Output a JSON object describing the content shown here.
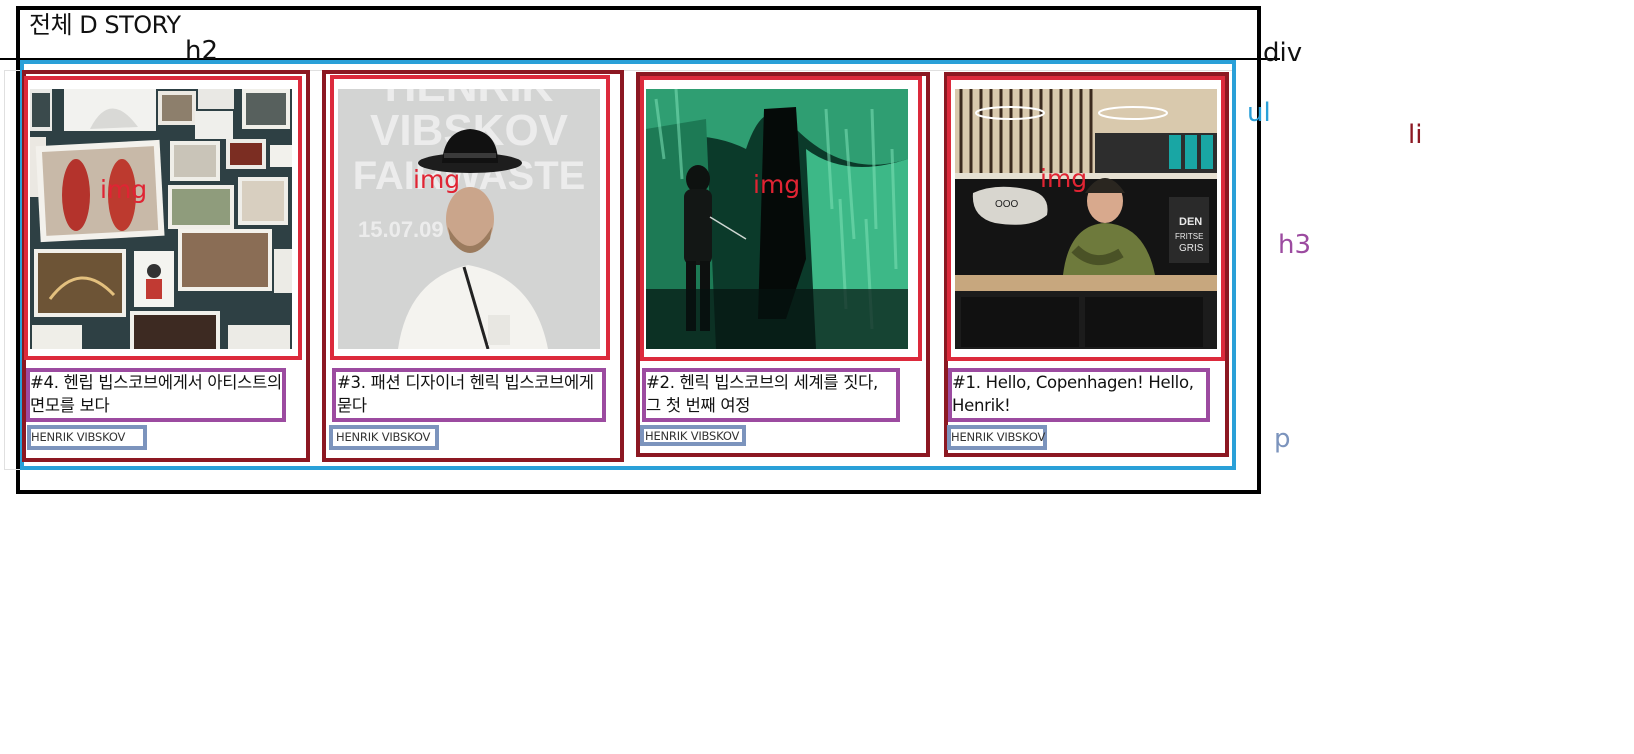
{
  "heading": "전체 D STORY",
  "labels": {
    "h2": "h2",
    "div": "div",
    "ul": "ul",
    "li": "li",
    "h3": "h3",
    "p": "p",
    "img": "img"
  },
  "cards": [
    {
      "title": "#4. 헨립 빕스코브에게서 아티스트의 면모를 보다",
      "author": "HENRIK VIBSKOV"
    },
    {
      "title": "#3. 패션 디자이너 헨릭 빕스코브에게 묻다",
      "author": "HENRIK VIBSKOV"
    },
    {
      "title": "#2. 헨릭 빕스코브의 세계를 짓다, 그 첫 번째 여정",
      "author": "HENRIK VIBSKOV"
    },
    {
      "title": "#1. Hello, Copenhagen! Hello, Henrik!",
      "author": "HENRIK VIBSKOV"
    }
  ],
  "photo_text": {
    "poster_line1": "HENRIK",
    "poster_line2": "VIBSKOV",
    "poster_line3": "FAIRWASTE",
    "poster_dates": "15.07.09",
    "shop_sign1": "DEN",
    "shop_sign2": "FRITSE",
    "shop_sign3": "GRIS"
  },
  "colors": {
    "div_border": "#000000",
    "ul_border": "#2aa0d8",
    "li_border": "#8c1822",
    "img_border": "#dc2a3c",
    "h3_border": "#9c4ba0",
    "p_border": "#7c94bd"
  }
}
